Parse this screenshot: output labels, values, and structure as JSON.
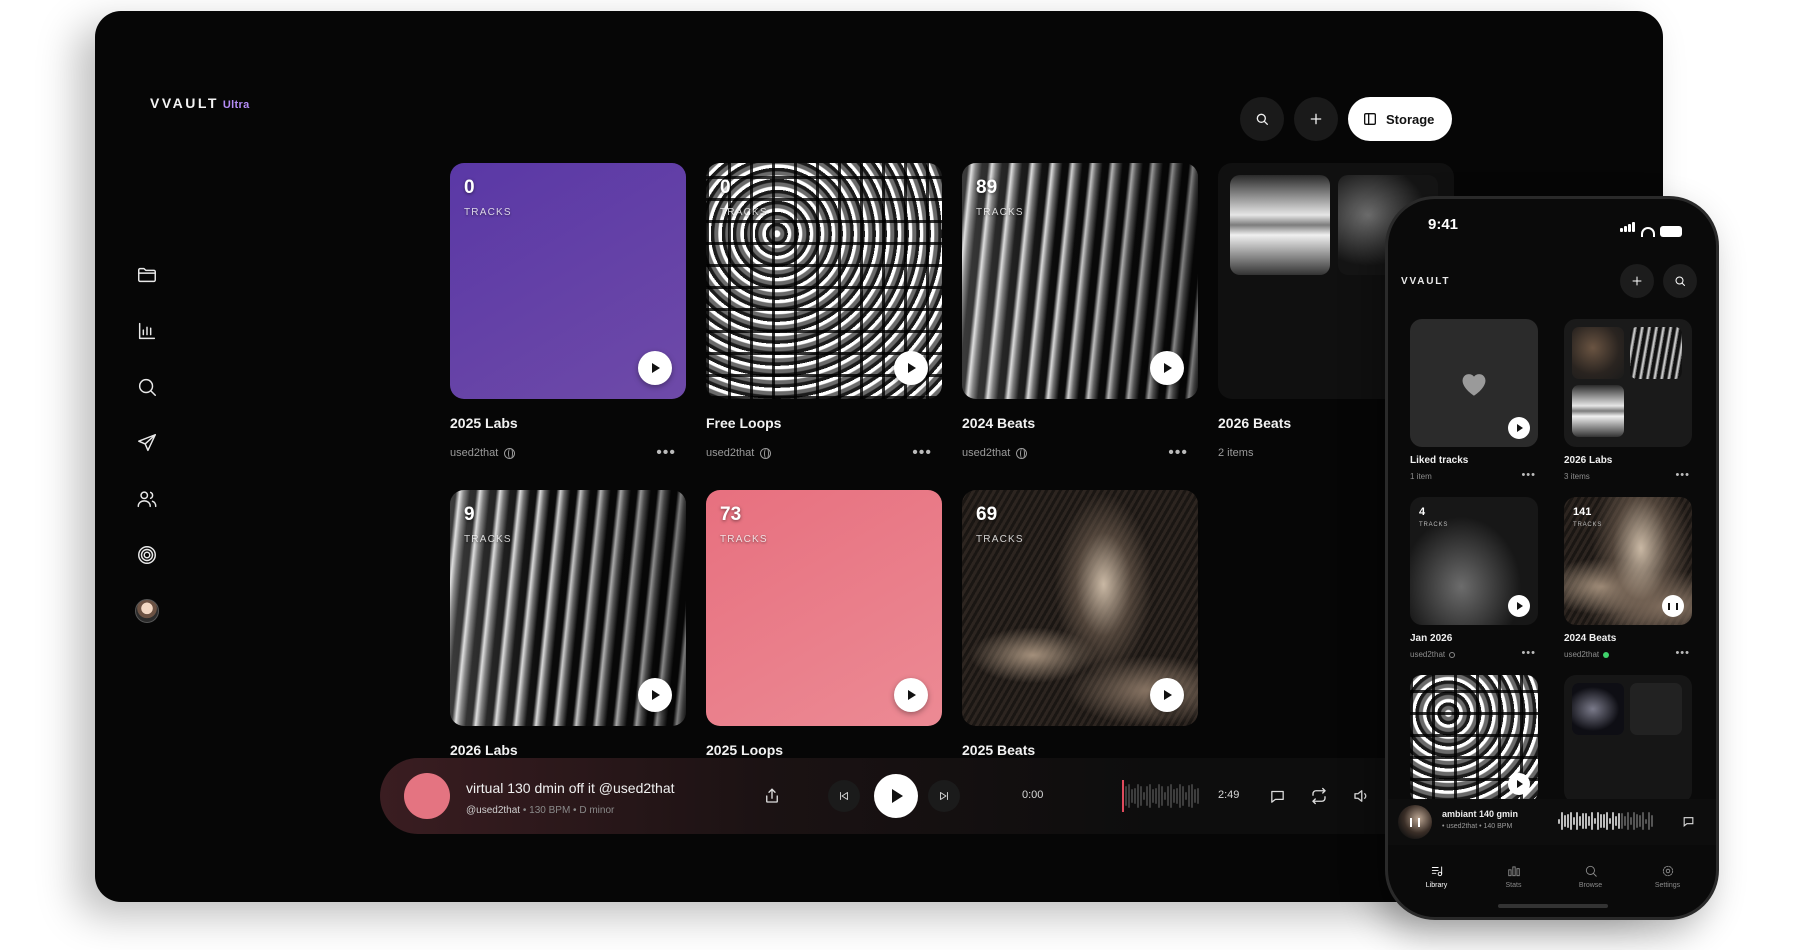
{
  "app": {
    "brand": "VVAULT",
    "tier": "Ultra"
  },
  "sidebar": {
    "items": [
      {
        "name": "folder-icon"
      },
      {
        "name": "bar-chart-icon"
      },
      {
        "name": "search-icon"
      },
      {
        "name": "send-icon"
      },
      {
        "name": "users-icon"
      },
      {
        "name": "target-icon"
      },
      {
        "name": "avatar"
      }
    ]
  },
  "header": {
    "storage_label": "Storage"
  },
  "cards": [
    {
      "count": "0",
      "tracks_label": "TRACKS",
      "title": "2025 Labs",
      "owner": "used2that"
    },
    {
      "count": "0",
      "tracks_label": "TRACKS",
      "title": "Free Loops",
      "owner": "used2that"
    },
    {
      "count": "89",
      "tracks_label": "TRACKS",
      "title": "2024 Beats",
      "owner": "used2that"
    },
    {
      "title": "2026 Beats",
      "items": "2 items"
    },
    {
      "count": "9",
      "tracks_label": "TRACKS",
      "title": "2026 Labs"
    },
    {
      "count": "73",
      "tracks_label": "TRACKS",
      "title": "2025 Loops"
    },
    {
      "count": "69",
      "tracks_label": "TRACKS",
      "title": "2025 Beats"
    }
  ],
  "player": {
    "title": "virtual 130 dmin off it @used2that",
    "artist": "@used2that",
    "details": "• 130 BPM • D minor",
    "current_time": "0:00",
    "duration": "2:49",
    "accent": "#e47481",
    "progress": 0
  },
  "phone": {
    "time": "9:41",
    "brand": "VVAULT",
    "cards": [
      {
        "title": "Liked tracks",
        "meta": "1 item"
      },
      {
        "title": "2026 Labs",
        "meta": "3 items"
      },
      {
        "count": "4",
        "tracks_label": "TRACKS",
        "title": "Jan 2026",
        "meta": "used2that"
      },
      {
        "count": "141",
        "tracks_label": "TRACKS",
        "title": "2024 Beats",
        "meta": "used2that"
      }
    ],
    "player": {
      "title": "ambiant 140 gmin",
      "sub": "• used2that • 140 BPM"
    },
    "tabs": [
      {
        "label": "Library",
        "icon": "library-icon"
      },
      {
        "label": "Stats",
        "icon": "stats-icon"
      },
      {
        "label": "Browse",
        "icon": "browse-icon"
      },
      {
        "label": "Settings",
        "icon": "settings-icon"
      }
    ]
  }
}
